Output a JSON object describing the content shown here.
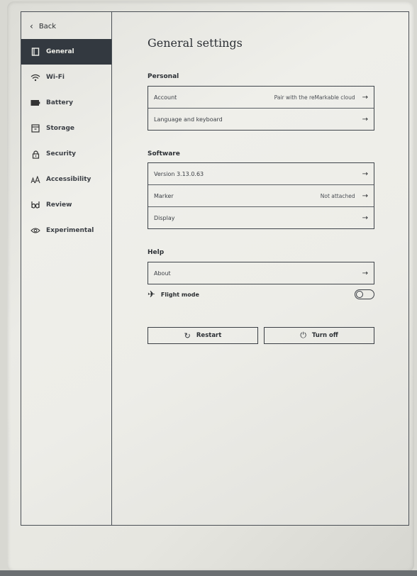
{
  "sidebar": {
    "back_label": "Back",
    "items": [
      {
        "label": "General",
        "icon": "general-icon",
        "active": true
      },
      {
        "label": "Wi-Fi",
        "icon": "wifi-icon"
      },
      {
        "label": "Battery",
        "icon": "battery-icon"
      },
      {
        "label": "Storage",
        "icon": "storage-icon"
      },
      {
        "label": "Security",
        "icon": "lock-icon"
      },
      {
        "label": "Accessibility",
        "icon": "accessibility-icon"
      },
      {
        "label": "Review",
        "icon": "review-icon"
      },
      {
        "label": "Experimental",
        "icon": "eye-icon"
      }
    ]
  },
  "main": {
    "title": "General settings",
    "personal": {
      "label": "Personal",
      "rows": [
        {
          "label": "Account",
          "value": "Pair with the reMarkable cloud"
        },
        {
          "label": "Language and keyboard",
          "value": ""
        }
      ]
    },
    "software": {
      "label": "Software",
      "rows": [
        {
          "label": "Version 3.13.0.63",
          "value": ""
        },
        {
          "label": "Marker",
          "value": "Not attached"
        },
        {
          "label": "Display",
          "value": ""
        }
      ]
    },
    "help": {
      "label": "Help",
      "rows": [
        {
          "label": "About",
          "value": ""
        }
      ]
    },
    "flight_mode": {
      "label": "Flight mode",
      "enabled": false
    },
    "restart_label": "Restart",
    "turn_off_label": "Turn off"
  },
  "colors": {
    "active_nav_bg": "#333940",
    "screen_bg": "#ededE8",
    "border": "#3f444a"
  }
}
